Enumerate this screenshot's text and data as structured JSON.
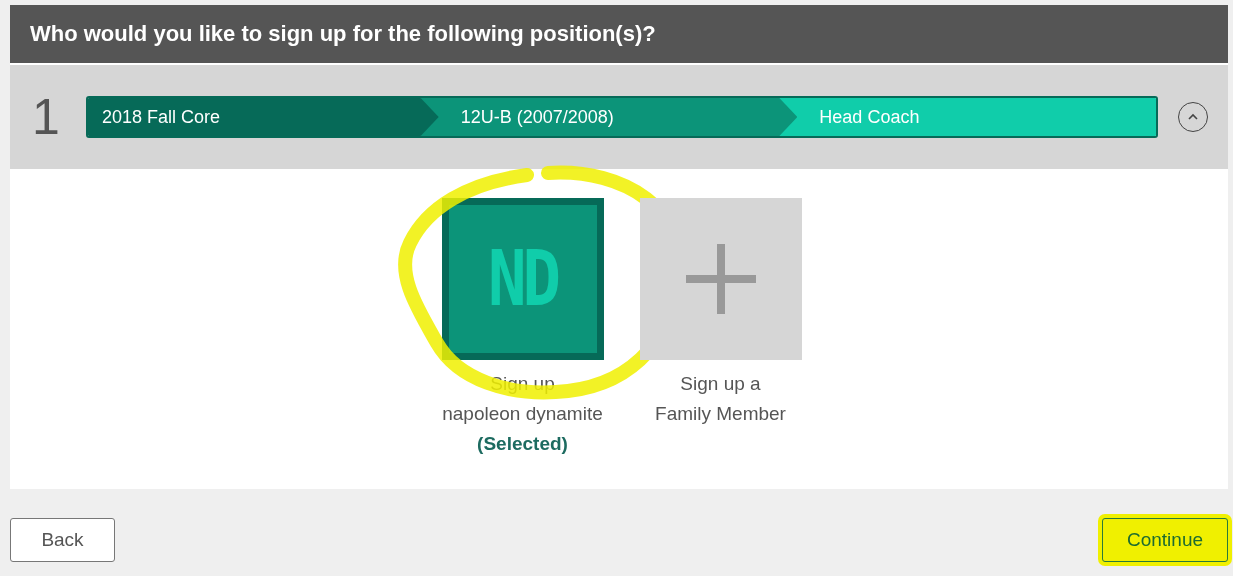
{
  "header": {
    "title": "Who would you like to sign up for the following position(s)?"
  },
  "position": {
    "number": "1",
    "expanded": true,
    "breadcrumb": [
      {
        "label": "2018 Fall Core"
      },
      {
        "label": "12U-B (2007/2008)"
      },
      {
        "label": "Head Coach"
      }
    ]
  },
  "options": [
    {
      "kind": "member",
      "initials": "ND",
      "label": "Sign up\nnapoleon dynamite",
      "selected": true,
      "status": "(Selected)",
      "circled": true
    },
    {
      "kind": "add",
      "label": "Sign up a\nFamily Member",
      "selected": false,
      "circled": false
    }
  ],
  "buttons": [
    {
      "label": "Back",
      "kind": "back",
      "highlighted": false
    },
    {
      "label": "Continue",
      "kind": "continue",
      "highlighted": true
    }
  ]
}
